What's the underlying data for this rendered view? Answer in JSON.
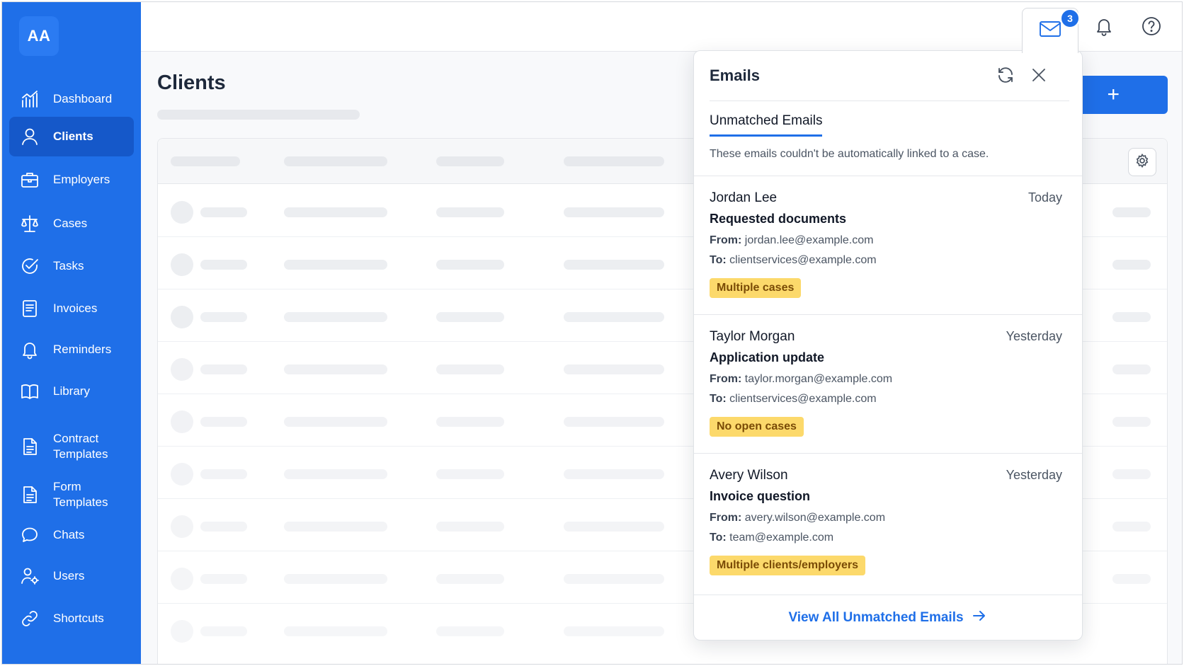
{
  "app": {
    "logo_text": "AA",
    "accent": "#1f6fe8"
  },
  "sidebar": {
    "items": [
      {
        "label": "Dashboard",
        "icon": "chart-icon"
      },
      {
        "label": "Clients",
        "icon": "user-icon",
        "active": true
      },
      {
        "label": "Employers",
        "icon": "briefcase-icon"
      },
      {
        "label": "Cases",
        "icon": "scale-icon"
      },
      {
        "label": "Tasks",
        "icon": "check-circle-icon"
      },
      {
        "label": "Invoices",
        "icon": "invoice-icon"
      },
      {
        "label": "Reminders",
        "icon": "bell-icon"
      },
      {
        "label": "Library",
        "icon": "book-icon"
      },
      {
        "label": "Contract Templates",
        "icon": "document-icon"
      },
      {
        "label": "Form Templates",
        "icon": "document-icon"
      },
      {
        "label": "Chats",
        "icon": "chat-icon"
      },
      {
        "label": "Users",
        "icon": "users-settings-icon"
      },
      {
        "label": "Shortcuts",
        "icon": "link-icon"
      }
    ]
  },
  "topbar": {
    "mail_badge": "3"
  },
  "main": {
    "page_title": "Clients",
    "add_button_label": "+"
  },
  "emails_panel": {
    "title": "Emails",
    "tab_label": "Unmatched Emails",
    "description": "These emails couldn't be automatically linked to a case.",
    "from_label": "From:",
    "to_label": "To:",
    "emails": [
      {
        "sender": "Jordan Lee",
        "when": "Today",
        "subject": "Requested documents",
        "from": "jordan.lee@example.com",
        "to": "clientservices@example.com",
        "tag": "Multiple cases"
      },
      {
        "sender": "Taylor Morgan",
        "when": "Yesterday",
        "subject": "Application update",
        "from": "taylor.morgan@example.com",
        "to": "clientservices@example.com",
        "tag": "No open cases"
      },
      {
        "sender": "Avery Wilson",
        "when": "Yesterday",
        "subject": "Invoice question",
        "from": "avery.wilson@example.com",
        "to": "team@example.com",
        "tag": "Multiple clients/employers"
      }
    ],
    "footer_link": "View All Unmatched Emails"
  }
}
